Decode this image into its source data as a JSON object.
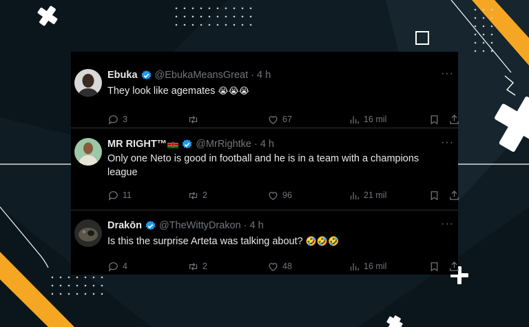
{
  "tweets": [
    {
      "display_name": "Ebuka",
      "handle": "@EbukaMeansGreat",
      "time": "4 h",
      "text": "They look like agemates",
      "emoji": "😭😭😭",
      "replies": "3",
      "retweets": "",
      "likes": "67",
      "views": "16 mil"
    },
    {
      "display_name": "MR RIGHT™",
      "handle": "@MrRightke",
      "time": "4 h",
      "text_line1": "Only one Neto is good in football and he is in a team with a champions",
      "text_line2": "league",
      "replies": "11",
      "retweets": "2",
      "likes": "96",
      "views": "21 mil"
    },
    {
      "display_name": "Drakōn",
      "handle": "@TheWittyDrakon",
      "time": "4 h",
      "text": "Is this the surprise Arteta was talking about?",
      "emoji": "🤣🤣🤣",
      "replies": "4",
      "retweets": "2",
      "likes": "48",
      "views": "16 mil"
    }
  ],
  "colors": {
    "background": "#0f1c24",
    "panel": "#000000",
    "accent_yellow": "#f5a623",
    "verified_blue": "#1d9bf0",
    "muted_text": "#71767b",
    "primary_text": "#e7e9ea"
  },
  "icons": {
    "reply": "reply-icon",
    "retweet": "retweet-icon",
    "like": "heart-icon",
    "views": "views-icon",
    "bookmark": "bookmark-icon",
    "share": "share-icon",
    "more": "more-icon",
    "verified": "verified-icon"
  }
}
